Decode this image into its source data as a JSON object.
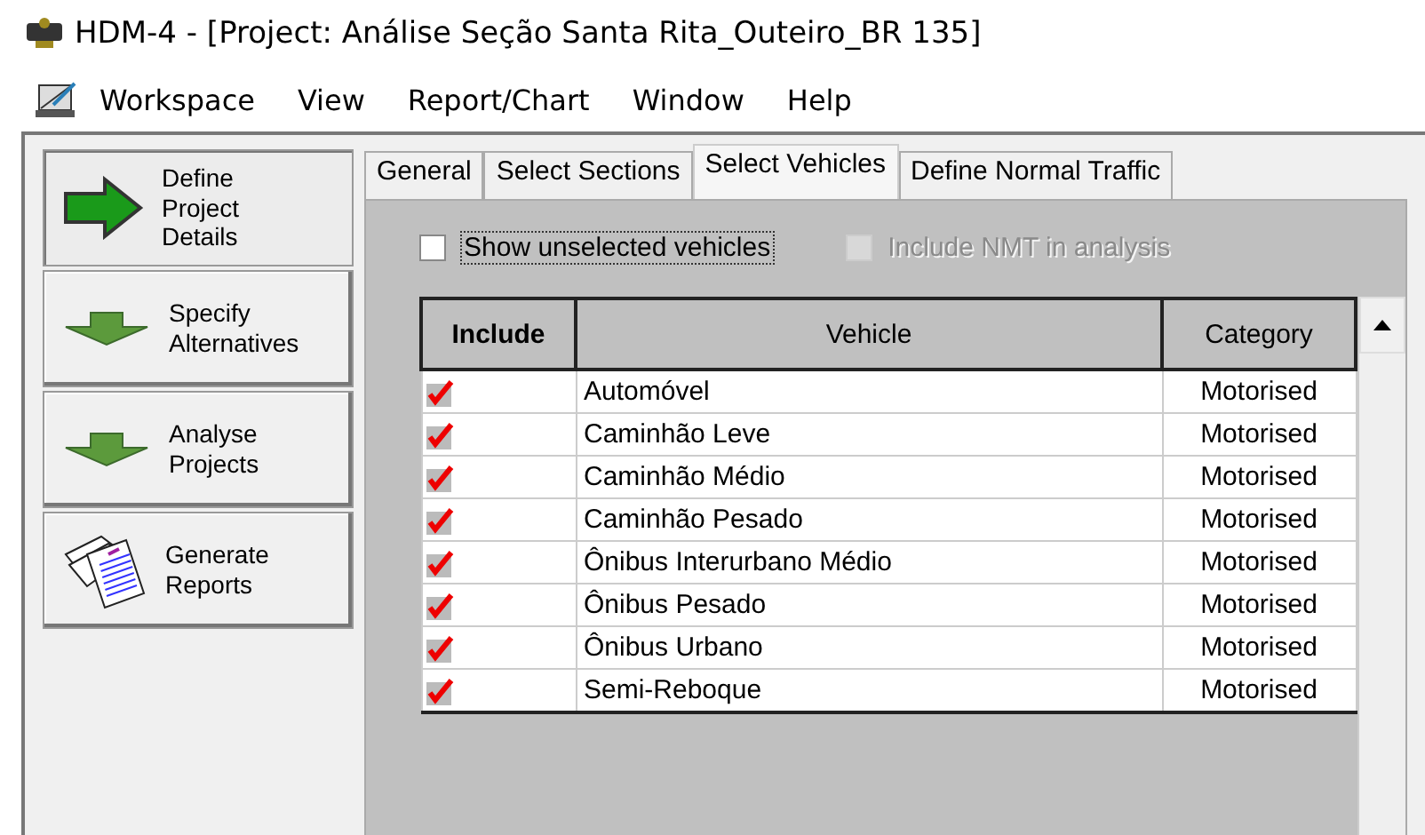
{
  "window": {
    "title": "HDM-4 - [Project: Análise Seção Santa Rita_Outeiro_BR 135]"
  },
  "menu": [
    "Workspace",
    "View",
    "Report/Chart",
    "Window",
    "Help"
  ],
  "sidebar": {
    "items": [
      {
        "label": "Define Project Details",
        "kind": "arrow-right",
        "selected": true
      },
      {
        "label": "Specify Alternatives",
        "kind": "arrow-down",
        "selected": false
      },
      {
        "label": "Analyse Projects",
        "kind": "arrow-down",
        "selected": false
      },
      {
        "label": "Generate Reports",
        "kind": "reports",
        "selected": false
      }
    ]
  },
  "tabs": [
    {
      "label": "General",
      "selected": false
    },
    {
      "label": "Select Sections",
      "selected": false
    },
    {
      "label": "Select Vehicles",
      "selected": true
    },
    {
      "label": "Define Normal Traffic",
      "selected": false
    }
  ],
  "options": [
    {
      "label": "Show unselected vehicles",
      "checked": false,
      "disabled": false
    },
    {
      "label": "Include NMT in analysis",
      "checked": false,
      "disabled": true
    }
  ],
  "table": {
    "columns": [
      "Include",
      "Vehicle",
      "Category"
    ],
    "rows": [
      {
        "include": true,
        "vehicle": "Automóvel",
        "category": "Motorised"
      },
      {
        "include": true,
        "vehicle": "Caminhão Leve",
        "category": "Motorised"
      },
      {
        "include": true,
        "vehicle": "Caminhão Médio",
        "category": "Motorised"
      },
      {
        "include": true,
        "vehicle": "Caminhão Pesado",
        "category": "Motorised"
      },
      {
        "include": true,
        "vehicle": "Ônibus Interurbano Médio",
        "category": "Motorised"
      },
      {
        "include": true,
        "vehicle": "Ônibus Pesado",
        "category": "Motorised"
      },
      {
        "include": true,
        "vehicle": "Ônibus Urbano",
        "category": "Motorised"
      },
      {
        "include": true,
        "vehicle": "Semi-Reboque",
        "category": "Motorised"
      }
    ]
  }
}
